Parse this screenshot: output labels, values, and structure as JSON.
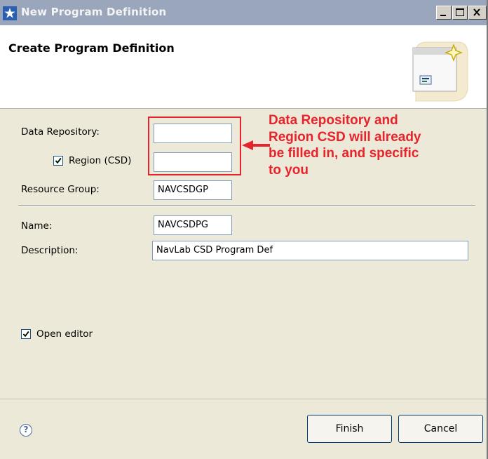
{
  "window": {
    "title": "New Program Definition",
    "controls": {
      "minimize": "_",
      "maximize": "□",
      "close": "×"
    }
  },
  "header": {
    "title": "Create Program Definition"
  },
  "form": {
    "data_repository_label": "Data Repository:",
    "data_repository_value": "",
    "region_checkbox_checked": true,
    "region_label": "Region (CSD)",
    "region_value": "",
    "resource_group_label": "Resource Group:",
    "resource_group_value": "NAVCSDGP",
    "name_label": "Name:",
    "name_value": "NAVCSDPG",
    "description_label": "Description:",
    "description_value": "NavLab CSD Program Def",
    "open_editor_checked": true,
    "open_editor_label": "Open editor"
  },
  "footer": {
    "help_icon": "?",
    "finish_label": "Finish",
    "cancel_label": "Cancel"
  },
  "annotation": {
    "lines": [
      "Data Repository and",
      "Region CSD will already",
      "be filled in, and specific",
      "to you"
    ],
    "color": "#e8232b"
  }
}
